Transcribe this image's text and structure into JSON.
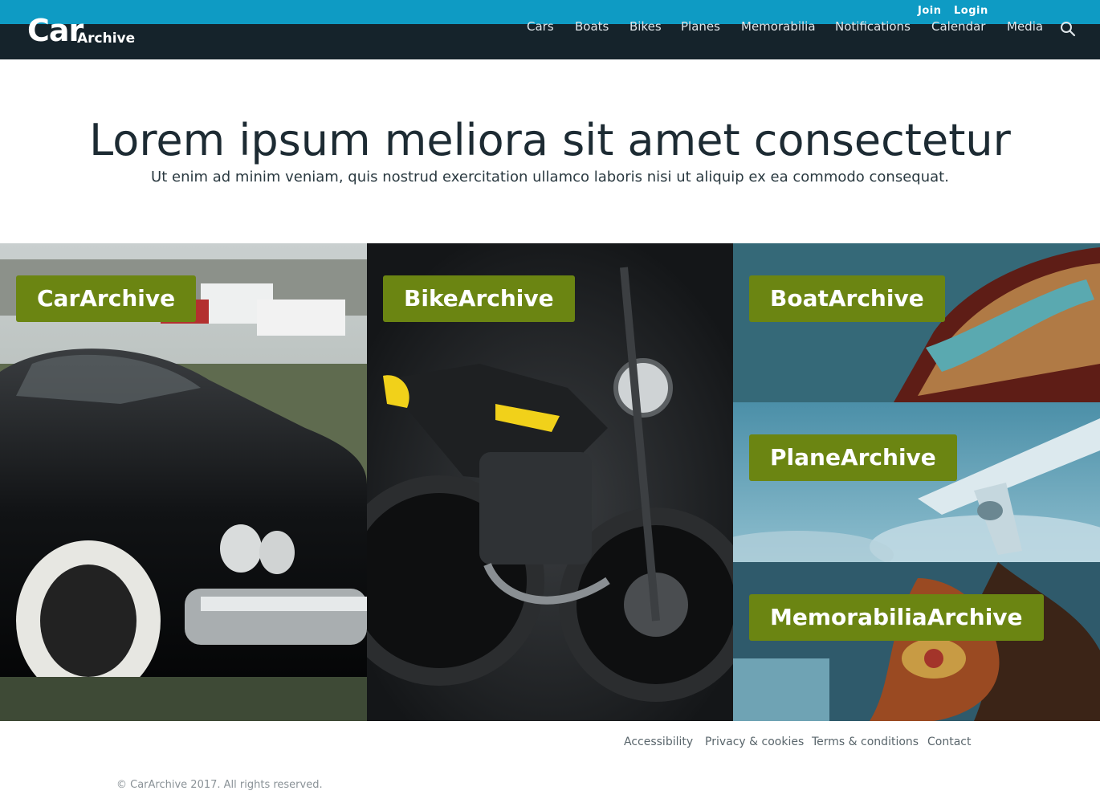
{
  "topbar": {
    "join": "Join",
    "login": "Login"
  },
  "header": {
    "logo_car": "Car",
    "logo_archive": "Archive",
    "nav": [
      "Cars",
      "Boats",
      "Bikes",
      "Planes",
      "Memorabilia",
      "Notifications",
      "Calendar",
      "Media"
    ]
  },
  "hero": {
    "title": "Lorem ipsum meliora sit amet consectetur",
    "subtitle": "Ut enim ad minim veniam, quis nostrud exercitation ullamco laboris nisi ut aliquip ex ea commodo consequat."
  },
  "tiles": {
    "car": "CarArchive",
    "bike": "BikeArchive",
    "boat": "BoatArchive",
    "plane": "PlaneArchive",
    "memorabilia": "MemorabiliaArchive"
  },
  "footer": {
    "links": [
      "Accessibility",
      "Privacy & cookies",
      "Terms & conditions",
      "Contact"
    ],
    "copyright": "© CarArchive 2017. All rights reserved."
  },
  "colors": {
    "topbar": "#0e9bc4",
    "header": "#15232b",
    "label_bg": "#6b8512"
  },
  "icons": {
    "search": "search-icon"
  }
}
